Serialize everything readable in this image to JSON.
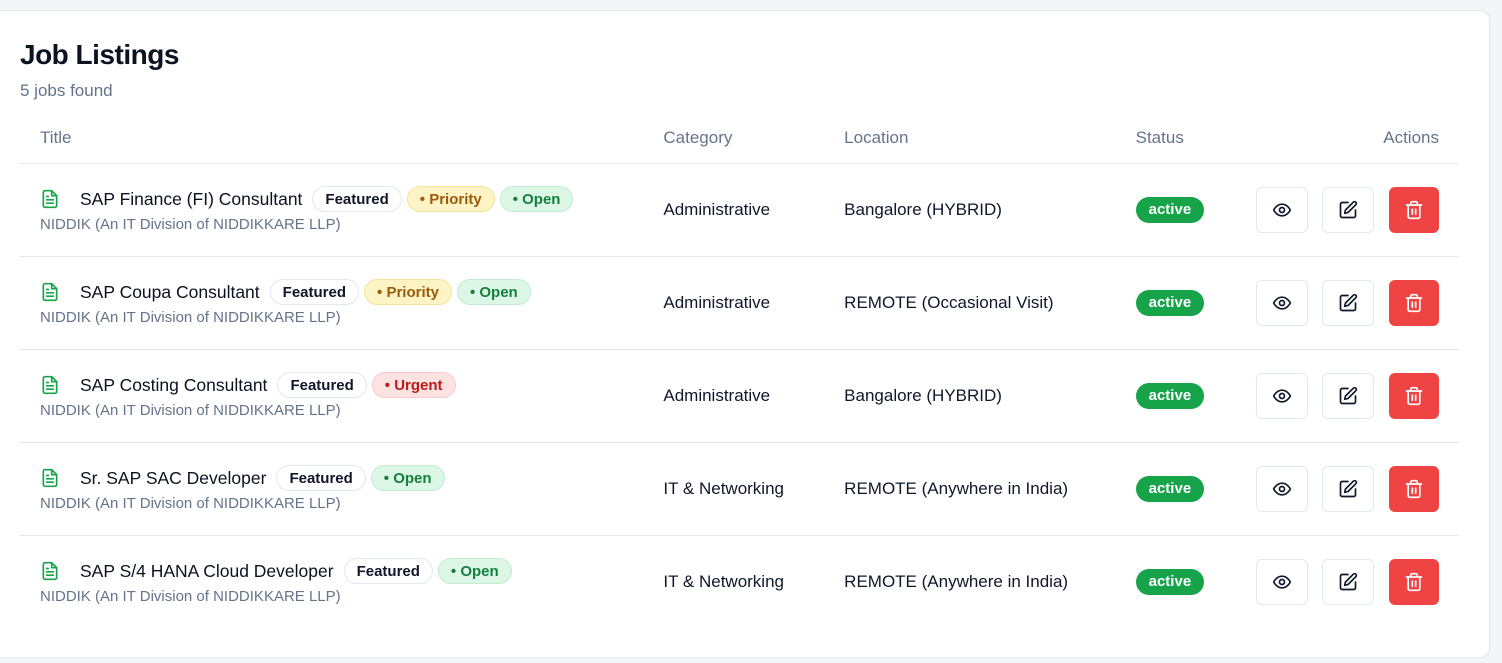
{
  "header": {
    "title": "Job Listings",
    "subtitle": "5 jobs found"
  },
  "table": {
    "columns": {
      "title": "Title",
      "category": "Category",
      "location": "Location",
      "status": "Status",
      "actions": "Actions"
    },
    "rows": [
      {
        "title": "SAP Finance (FI) Consultant",
        "badges": [
          {
            "type": "featured",
            "label": "Featured"
          },
          {
            "type": "priority",
            "label": "• Priority"
          },
          {
            "type": "open",
            "label": "• Open"
          }
        ],
        "company": "NIDDIK (An IT Division of NIDDIKKARE LLP)",
        "category": "Administrative",
        "location": "Bangalore (HYBRID)",
        "status": "active"
      },
      {
        "title": "SAP Coupa Consultant",
        "badges": [
          {
            "type": "featured",
            "label": "Featured"
          },
          {
            "type": "priority",
            "label": "• Priority"
          },
          {
            "type": "open",
            "label": "• Open"
          }
        ],
        "company": "NIDDIK (An IT Division of NIDDIKKARE LLP)",
        "category": "Administrative",
        "location": "REMOTE (Occasional Visit)",
        "status": "active"
      },
      {
        "title": "SAP Costing Consultant",
        "badges": [
          {
            "type": "featured",
            "label": "Featured"
          },
          {
            "type": "urgent",
            "label": "• Urgent"
          }
        ],
        "company": "NIDDIK (An IT Division of NIDDIKKARE LLP)",
        "category": "Administrative",
        "location": "Bangalore (HYBRID)",
        "status": "active"
      },
      {
        "title": "Sr. SAP SAC Developer",
        "badges": [
          {
            "type": "featured",
            "label": "Featured"
          },
          {
            "type": "open",
            "label": "• Open"
          }
        ],
        "company": "NIDDIK (An IT Division of NIDDIKKARE LLP)",
        "category": "IT & Networking",
        "location": "REMOTE (Anywhere in India)",
        "status": "active"
      },
      {
        "title": "SAP S/4 HANA Cloud Developer",
        "badges": [
          {
            "type": "featured",
            "label": "Featured"
          },
          {
            "type": "open",
            "label": "• Open"
          }
        ],
        "company": "NIDDIK (An IT Division of NIDDIKKARE LLP)",
        "category": "IT & Networking",
        "location": "REMOTE (Anywhere in India)",
        "status": "active"
      }
    ]
  },
  "icons": {
    "row_icon": "document-icon",
    "view": "eye-icon",
    "edit": "edit-icon",
    "delete": "trash-icon"
  },
  "colors": {
    "status_active": "#16a34a",
    "delete_button": "#ef4444",
    "document_icon": "#16a34a"
  }
}
